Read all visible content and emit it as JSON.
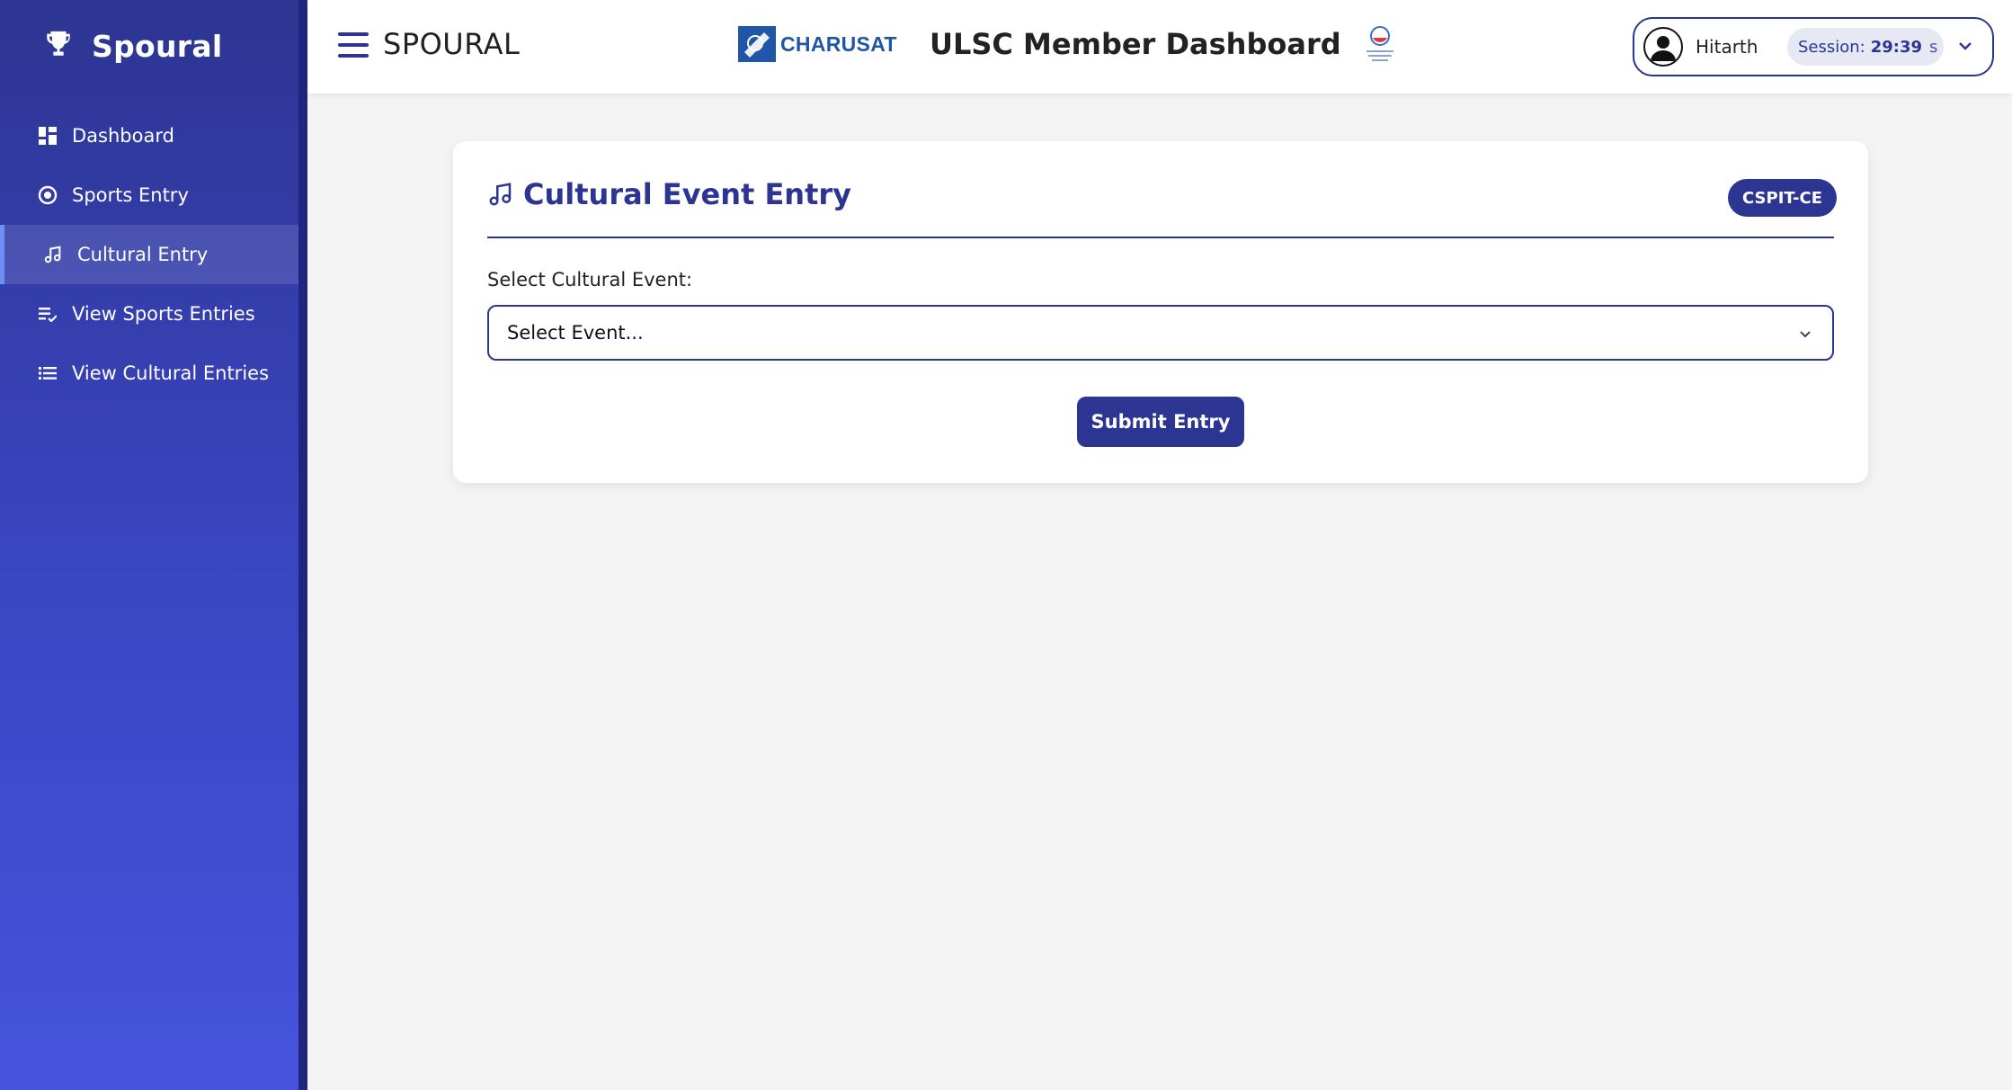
{
  "brand": {
    "name": "Spoural",
    "icon": "trophy-icon"
  },
  "sidebar": {
    "items": [
      {
        "label": "Dashboard",
        "icon": "dashboard-icon",
        "active": false
      },
      {
        "label": "Sports Entry",
        "icon": "sports-icon",
        "active": false
      },
      {
        "label": "Cultural Entry",
        "icon": "music-icon",
        "active": true
      },
      {
        "label": "View Sports Entries",
        "icon": "playlist-icon",
        "active": false
      },
      {
        "label": "View Cultural Entries",
        "icon": "list-icon",
        "active": false
      }
    ]
  },
  "header": {
    "title": "SPOURAL",
    "university": "CHARUSAT",
    "dashboard_title": "ULSC Member Dashboard",
    "user": {
      "name": "Hitarth"
    },
    "session": {
      "label": "Session:",
      "value": "29:39",
      "unit": "s"
    }
  },
  "form": {
    "title": "Cultural Event Entry",
    "department_badge": "CSPIT-CE",
    "field_label": "Select Cultural Event:",
    "select_placeholder": "Select Event...",
    "submit_label": "Submit Entry"
  },
  "colors": {
    "primary": "#2d3592",
    "sidebar_bottom": "#4653dd",
    "background": "#f4f4f4"
  }
}
